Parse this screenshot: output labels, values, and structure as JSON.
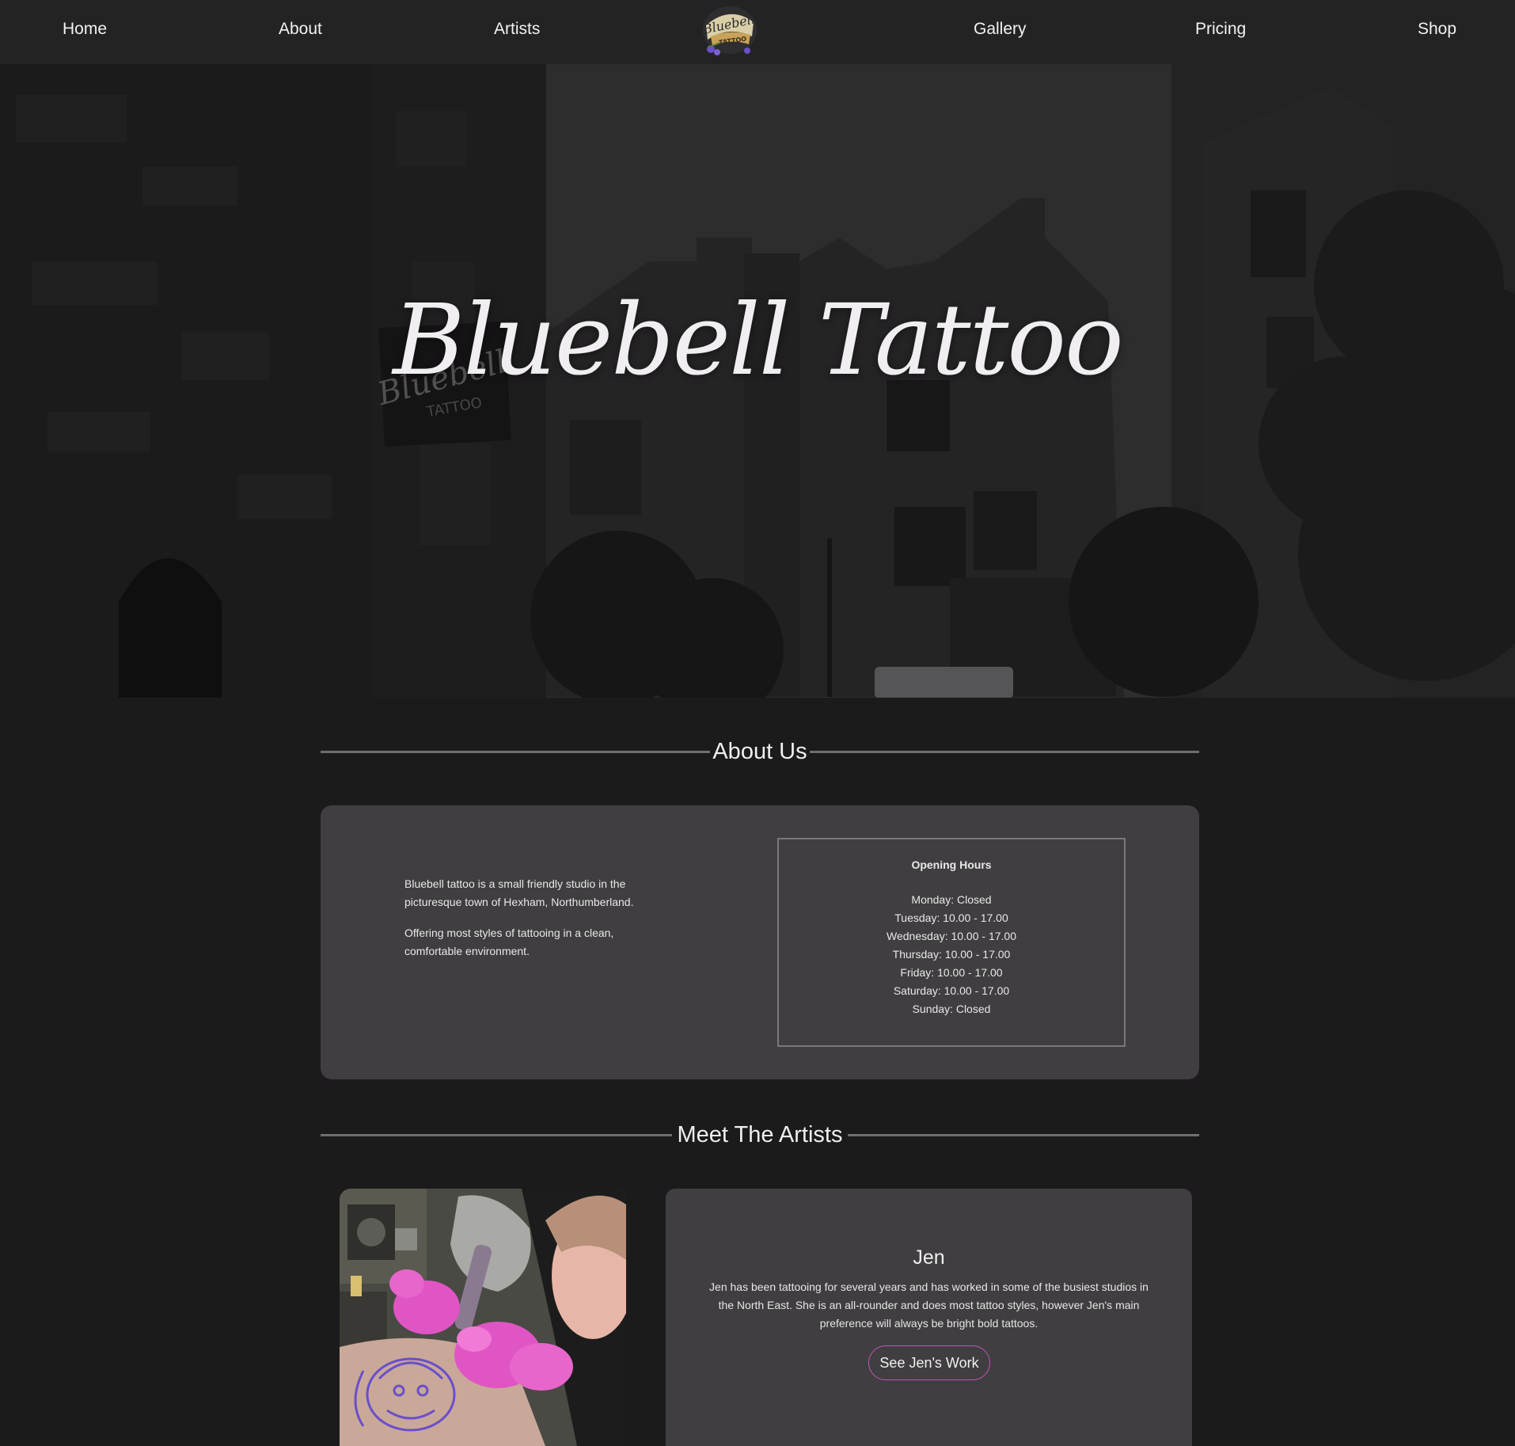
{
  "nav": {
    "items": [
      {
        "label": "Home"
      },
      {
        "label": "About"
      },
      {
        "label": "Artists"
      },
      {
        "label": "Gallery"
      },
      {
        "label": "Pricing"
      },
      {
        "label": "Shop"
      }
    ],
    "logo_text": "Bluebell",
    "logo_subtext": "TATTOO"
  },
  "hero": {
    "title": "Bluebell Tattoo",
    "sign_text": "Bluebell",
    "sign_subtext": "TATTOO"
  },
  "about": {
    "heading": "About Us",
    "paragraphs": [
      "Bluebell tattoo is a small friendly studio in the picturesque town of Hexham, Northumberland.",
      "Offering most styles of tattooing in a clean, comfortable environment."
    ],
    "hours": {
      "title": "Opening Hours",
      "days": [
        "Monday: Closed",
        "Tuesday: 10.00 - 17.00",
        "Wednesday: 10.00 - 17.00",
        "Thursday: 10.00 - 17.00",
        "Friday: 10.00 - 17.00",
        "Saturday: 10.00 - 17.00",
        "Sunday: Closed"
      ]
    }
  },
  "artists": {
    "heading": "Meet The Artists",
    "items": [
      {
        "name": "Jen",
        "bio": "Jen has been tattooing for several years and has worked in some of the busiest studios in the North East. She is an all-rounder and does most tattoo styles, however Jen's main preference will always be bright bold tattoos.",
        "button_label": "See Jen's Work"
      }
    ]
  },
  "colors": {
    "nav_background": "#232324",
    "page_background": "#1b1b1c",
    "card_background": "#403e40",
    "button_border": "#c455b8",
    "glove_pink": "#e055c4",
    "ink_purple": "#6a4fc9"
  }
}
